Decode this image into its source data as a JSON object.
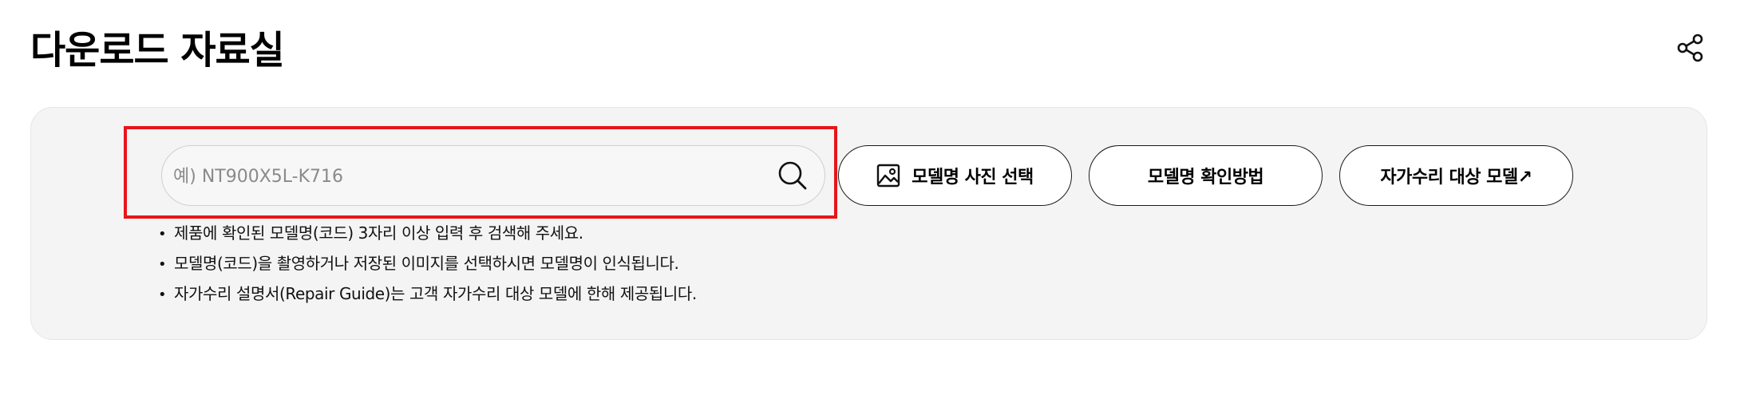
{
  "header": {
    "title": "다운로드 자료실",
    "share_icon": "share-icon"
  },
  "search": {
    "placeholder": "예) NT900X5L-K716",
    "value": "",
    "search_icon": "search-icon"
  },
  "buttons": {
    "photo_select": "모델명 사진 선택",
    "photo_icon": "image-icon",
    "model_check": "모델명 확인방법",
    "self_repair": "자가수리 대상 모델↗"
  },
  "notes": [
    "제품에 확인된 모델명(코드) 3자리 이상 입력 후 검색해 주세요.",
    "모델명(코드)을 촬영하거나 저장된 이미지를 선택하시면 모델명이 인식됩니다.",
    "자가수리 설명서(Repair Guide)는 고객 자가수리 대상 모델에 한해 제공됩니다."
  ],
  "colors": {
    "highlight": "#e8151b",
    "panel_bg": "#f4f4f4"
  }
}
